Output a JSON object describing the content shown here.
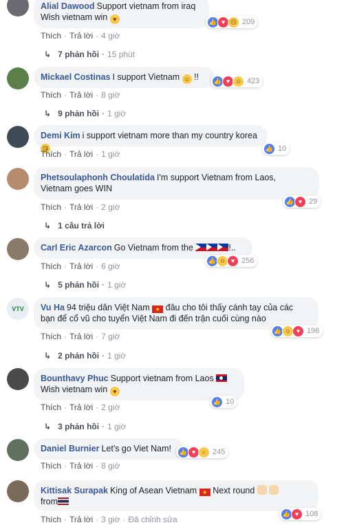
{
  "labels": {
    "like": "Thích",
    "reply": "Trả lời",
    "edited": "Đã chỉnh sửa",
    "dot": "·"
  },
  "colors": {
    "author": "#385898",
    "bubble": "#f2f3f5",
    "like": "#4f7ef8",
    "love": "#f33e58",
    "emoji": "#f7c84b"
  },
  "comments": [
    {
      "author": "Alial Dawood",
      "line1": "Support vietnam from iraq",
      "line2": "Wish vietnam win",
      "line2_emoji": "heart-eyes-emoji",
      "time": "4 giờ",
      "reactions": [
        "like",
        "love",
        "sad"
      ],
      "count": "209",
      "replies": "7 phản hồi",
      "replies_time": "15 phút"
    },
    {
      "author": "Mickael Costinas",
      "line1": "I support Vietnam",
      "line1_suffix": "!!",
      "line1_emoji": "smile-emoji",
      "time": "8 giờ",
      "reactions": [
        "like",
        "love",
        "haha"
      ],
      "count": "423",
      "replies": "9 phản hồi",
      "replies_time": "1 giờ"
    },
    {
      "author": "Demi Kim",
      "line1": "i support vietnam more than my country korea",
      "line1_emoji": "kiss-emoji",
      "time": "1 giờ",
      "reactions": [
        "like"
      ],
      "count": "10"
    },
    {
      "author": "Phetsoulaphonh Choulatida",
      "line1": "I'm support Vietnam from Laos,",
      "line2": "Vietnam goes WIN",
      "time": "2 giờ",
      "reactions": [
        "like",
        "love"
      ],
      "count": "29",
      "replies": "1 câu trả lời"
    },
    {
      "author": "Carl Eric Azarcon",
      "line1": "Go Vietnam from the",
      "line1_suffix": "!..",
      "time": "6 giờ",
      "reactions": [
        "like",
        "haha",
        "love"
      ],
      "count": "256",
      "replies": "5 phản hồi",
      "replies_time": "1 giờ"
    },
    {
      "author": "Vu Ha",
      "line1_pre": "94 triệu dân Việt Nam",
      "line1": "đâu cho tôi thấy cánh tay của các",
      "line2": "bạn để cổ vũ cho tuyển Việt Nam đi đến trận cuối cùng nào",
      "time": "7 giờ",
      "reactions": [
        "like",
        "haha",
        "love"
      ],
      "count": "196",
      "replies": "2 phản hồi",
      "replies_time": "1 giờ"
    },
    {
      "author": "Bounthavy Phuc",
      "line1": "Support vietnam from Laos",
      "line2": "Wish vietnam win",
      "time": "2 giờ",
      "reactions": [
        "like"
      ],
      "count": "10",
      "replies": "3 phản hồi",
      "replies_time": "1 giờ"
    },
    {
      "author": "Daniel Burnier",
      "line1": "Let's go Viet Nam!",
      "time": "8 giờ",
      "reactions": [
        "like",
        "love",
        "wow"
      ],
      "count": "245"
    },
    {
      "author": "Kittisak Surapak",
      "line1": "King of Asean Vietnam",
      "line1_suffix": "Next round",
      "line2": "from",
      "time": "3 giờ",
      "reactions": [
        "like",
        "love"
      ],
      "count": "108"
    }
  ]
}
